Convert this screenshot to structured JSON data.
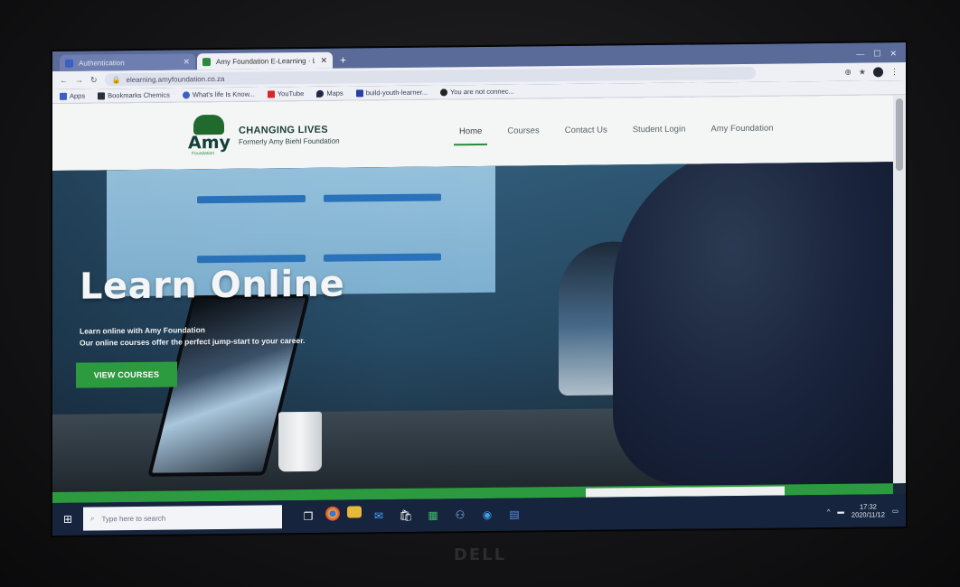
{
  "browser": {
    "tabs": [
      {
        "title": "Authentication",
        "active": false
      },
      {
        "title": "Amy Foundation E-Learning · Le",
        "active": true
      }
    ],
    "new_tab": "+",
    "url": "elearning.amyfoundation.co.za",
    "bookmarks": [
      {
        "label": "Apps",
        "icon": "apps-icon"
      },
      {
        "label": "Bookmarks Chemics",
        "icon": "folder-icon"
      },
      {
        "label": "What's life Is Know...",
        "icon": "heart-icon"
      },
      {
        "label": "YouTube",
        "icon": "youtube-icon"
      },
      {
        "label": "Maps",
        "icon": "maps-icon"
      },
      {
        "label": "build-youth-learner...",
        "icon": "bookmark-icon"
      },
      {
        "label": "You are not connec...",
        "icon": "globe-icon"
      }
    ]
  },
  "site": {
    "logo_word": "Amy",
    "logo_sub": "Foundation",
    "tagline": "CHANGING LIVES",
    "formerly": "Formerly Amy Biehl Foundation",
    "nav": [
      {
        "label": "Home",
        "active": true
      },
      {
        "label": "Courses",
        "active": false
      },
      {
        "label": "Contact Us",
        "active": false
      },
      {
        "label": "Student Login",
        "active": false
      },
      {
        "label": "Amy Foundation",
        "active": false
      }
    ],
    "hero": {
      "title": "Learn Online",
      "line1": "Learn online with Amy Foundation",
      "line2": "Our online courses offer the perfect jump-start to your career.",
      "cta": "VIEW COURSES"
    }
  },
  "taskbar": {
    "search_placeholder": "Type here to search",
    "time": "17:32",
    "date": "2020/11/12"
  },
  "monitor": {
    "brand": "DELL"
  },
  "colors": {
    "accent_green": "#2c9a3e",
    "taskbar": "#16243e",
    "tabbar": "#5a6b9a"
  }
}
